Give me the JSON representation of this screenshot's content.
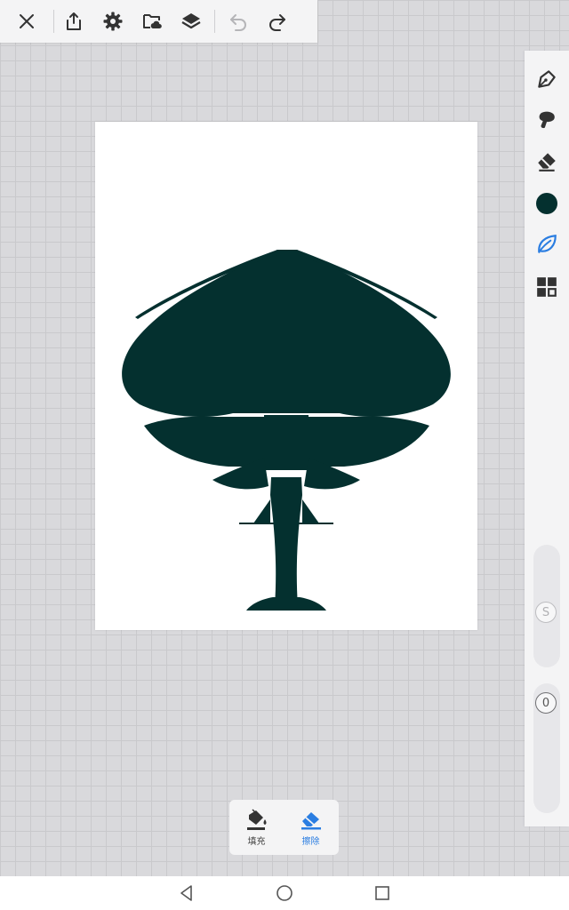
{
  "top_toolbar": {
    "icons": [
      "close-icon",
      "share-icon",
      "settings-icon",
      "cloud-save-icon",
      "layers-icon",
      "undo-icon",
      "redo-icon"
    ]
  },
  "right_toolbar": {
    "icons": [
      "pen-icon",
      "smudge-icon",
      "eraser-icon",
      "color-swatch",
      "leaf-brush-icon",
      "grid-icon"
    ],
    "current_color": "#04302f",
    "active_color": "#2a7de1",
    "size_slider_label": "S",
    "opacity_slider_label": "0"
  },
  "canvas": {
    "fill_color": "#04302f"
  },
  "bottom_panel": {
    "fill_label": "填充",
    "erase_label": "擦除"
  },
  "nav": {
    "icons": [
      "back-icon",
      "home-icon",
      "recents-icon"
    ]
  }
}
